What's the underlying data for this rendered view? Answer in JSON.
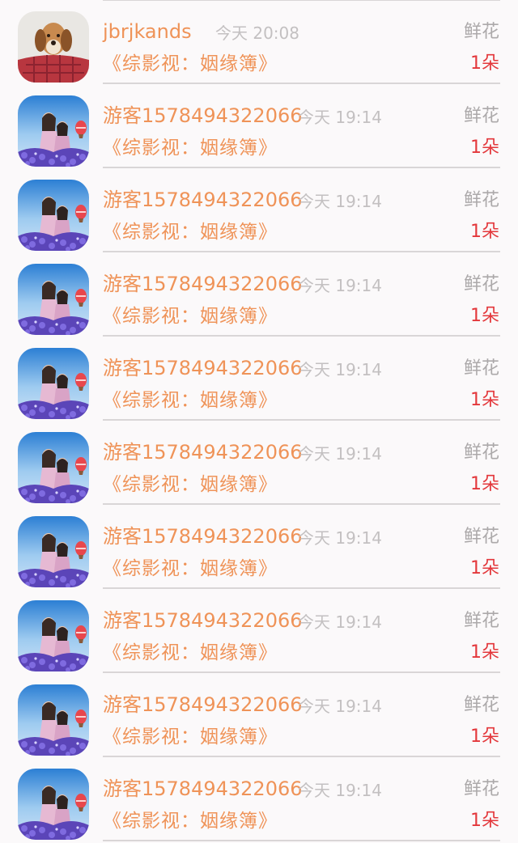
{
  "records": [
    {
      "user": "jbrjkands",
      "time": "今天 20:08",
      "gift_type": "鲜花",
      "book": "《综影视：姻缘簿》",
      "count": "1朵",
      "avatar": "dog-avatar"
    },
    {
      "user": "游客1578494322066",
      "time": "今天 19:14",
      "gift_type": "鲜花",
      "book": "《综影视：姻缘簿》",
      "count": "1朵",
      "avatar": "couple-photo-avatar"
    },
    {
      "user": "游客1578494322066",
      "time": "今天 19:14",
      "gift_type": "鲜花",
      "book": "《综影视：姻缘簿》",
      "count": "1朵",
      "avatar": "couple-photo-avatar"
    },
    {
      "user": "游客1578494322066",
      "time": "今天 19:14",
      "gift_type": "鲜花",
      "book": "《综影视：姻缘簿》",
      "count": "1朵",
      "avatar": "couple-photo-avatar"
    },
    {
      "user": "游客1578494322066",
      "time": "今天 19:14",
      "gift_type": "鲜花",
      "book": "《综影视：姻缘簿》",
      "count": "1朵",
      "avatar": "couple-photo-avatar"
    },
    {
      "user": "游客1578494322066",
      "time": "今天 19:14",
      "gift_type": "鲜花",
      "book": "《综影视：姻缘簿》",
      "count": "1朵",
      "avatar": "couple-photo-avatar"
    },
    {
      "user": "游客1578494322066",
      "time": "今天 19:14",
      "gift_type": "鲜花",
      "book": "《综影视：姻缘簿》",
      "count": "1朵",
      "avatar": "couple-photo-avatar"
    },
    {
      "user": "游客1578494322066",
      "time": "今天 19:14",
      "gift_type": "鲜花",
      "book": "《综影视：姻缘簿》",
      "count": "1朵",
      "avatar": "couple-photo-avatar"
    },
    {
      "user": "游客1578494322066",
      "time": "今天 19:14",
      "gift_type": "鲜花",
      "book": "《综影视：姻缘簿》",
      "count": "1朵",
      "avatar": "couple-photo-avatar"
    },
    {
      "user": "游客1578494322066",
      "time": "今天 19:14",
      "gift_type": "鲜花",
      "book": "《综影视：姻缘簿》",
      "count": "1朵",
      "avatar": "couple-photo-avatar"
    }
  ],
  "colors": {
    "accent_orange": "#ef9358",
    "count_red": "#e3373b",
    "muted_gray": "#aca9aa",
    "time_gray": "#c3c0c1",
    "divider": "#d9d6d7",
    "background": "#fbf9fa"
  }
}
